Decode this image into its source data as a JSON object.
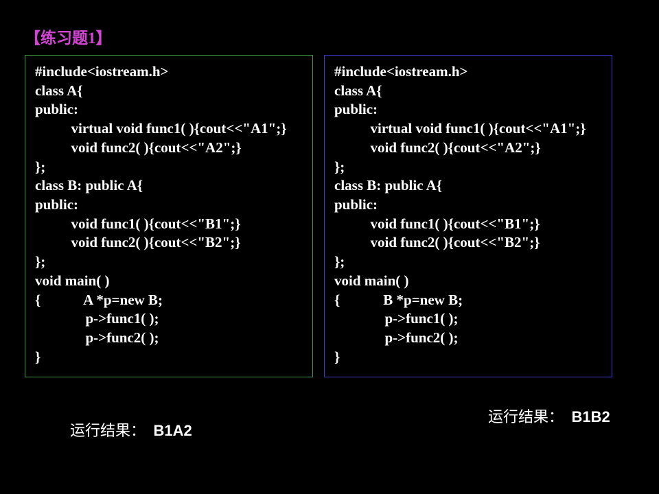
{
  "title": "【练习题1】",
  "left": {
    "code": [
      "#include<iostream.h>",
      "class A{",
      "public:",
      "          virtual void func1( ){cout<<\"A1\";}",
      "          void func2( ){cout<<\"A2\";}",
      "};",
      "class B: public A{",
      "public:",
      "          void func1( ){cout<<\"B1\";}",
      "          void func2( ){cout<<\"B2\";}",
      "};",
      "void main( )",
      "{            A *p=new B;",
      "              p->func1( );",
      "              p->func2( );",
      "}"
    ],
    "result_label": "运行结果：",
    "result_value": "B1A2"
  },
  "right": {
    "code": [
      "#include<iostream.h>",
      "class A{",
      "public:",
      "          virtual void func1( ){cout<<\"A1\";}",
      "          void func2( ){cout<<\"A2\";}",
      "};",
      "class B: public A{",
      "public:",
      "          void func1( ){cout<<\"B1\";}",
      "          void func2( ){cout<<\"B2\";}",
      "};",
      "void main( )",
      "{            B *p=new B;",
      "              p->func1( );",
      "              p->func2( );",
      "}"
    ],
    "result_label": "运行结果：",
    "result_value": "B1B2"
  }
}
